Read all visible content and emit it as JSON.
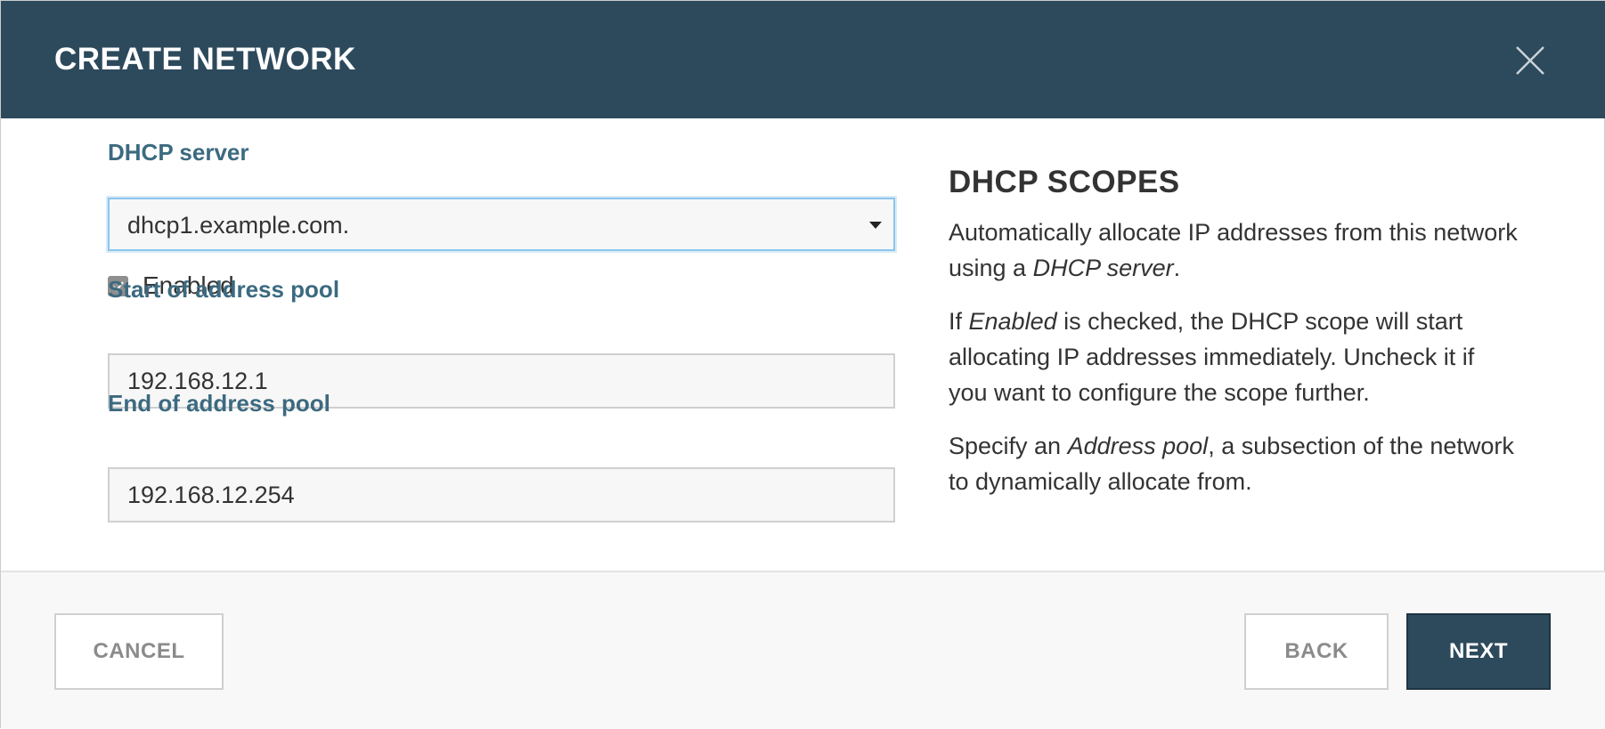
{
  "dialog": {
    "title": "CREATE NETWORK"
  },
  "form": {
    "dhcp_server": {
      "label": "DHCP server",
      "selected": "dhcp1.example.com."
    },
    "enabled": {
      "label": "Enabled",
      "checked": true
    },
    "pool_start": {
      "label": "Start of address pool",
      "value": "192.168.12.1"
    },
    "pool_end": {
      "label": "End of address pool",
      "value": "192.168.12.254"
    }
  },
  "help": {
    "title": "DHCP SCOPES",
    "p1_prefix": "Automatically allocate IP addresses from this network using a ",
    "p1_em": "DHCP server",
    "p1_suffix": ".",
    "p2_prefix": "If ",
    "p2_em": "Enabled",
    "p2_suffix": " is checked, the DHCP scope will start allocating IP addresses immediately. Uncheck it if you want to configure the scope further.",
    "p3_prefix": "Specify an ",
    "p3_em": "Address pool",
    "p3_suffix": ", a subsection of the network to dynamically allocate from."
  },
  "footer": {
    "cancel_label": "CANCEL",
    "back_label": "BACK",
    "next_label": "NEXT"
  },
  "colors": {
    "header_bg": "#2d4a5c",
    "label_color": "#3c6a80",
    "focus_border": "#8cc6ec",
    "primary_button": "#2d4a5c"
  },
  "icons": {
    "close": "close-icon",
    "dropdown": "caret-down-icon",
    "checkbox": "check-icon"
  }
}
